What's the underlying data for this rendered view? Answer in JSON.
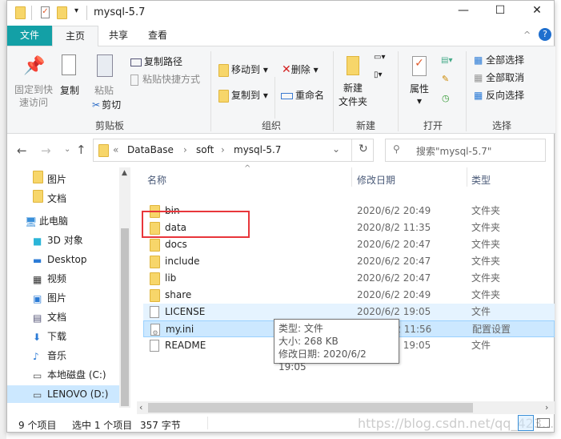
{
  "window": {
    "title": "mysql-5.7",
    "minimize": "—",
    "maximize": "☐",
    "close": "✕"
  },
  "tabs": [
    {
      "label": "文件",
      "active": false,
      "color": "#13a0a6"
    },
    {
      "label": "主页",
      "active": true
    },
    {
      "label": "共享"
    },
    {
      "label": "查看"
    }
  ],
  "ribbon": {
    "clipboard": {
      "label": "剪贴板",
      "pin": "固定到快速访问",
      "pin1": "固定到快",
      "pin2": "速访问",
      "copy": "复制",
      "paste": "粘贴",
      "copy_path": "复制路径",
      "paste_shortcut": "粘贴快捷方式",
      "cut": "剪切"
    },
    "organize": {
      "label": "组织",
      "move_to": "移动到",
      "copy_to": "复制到",
      "delete": "删除",
      "rename": "重命名"
    },
    "new": {
      "label": "新建",
      "new_folder1": "新建",
      "new_folder2": "文件夹"
    },
    "open": {
      "label": "打开",
      "properties": "属性"
    },
    "select": {
      "label": "选择",
      "select_all": "全部选择",
      "select_none": "全部取消",
      "invert": "反向选择"
    }
  },
  "address": {
    "breadcrumb": [
      "DataBase",
      "soft",
      "mysql-5.7"
    ],
    "prefix": "«",
    "search_placeholder": "搜索\"mysql-5.7\""
  },
  "nav": [
    {
      "label": "图片",
      "icon": "folder-icon"
    },
    {
      "label": "文档",
      "icon": "folder-icon"
    },
    {
      "label": "此电脑",
      "icon": "computer-icon"
    },
    {
      "label": "3D 对象",
      "icon": "cube-icon"
    },
    {
      "label": "Desktop",
      "icon": "desktop-icon"
    },
    {
      "label": "视频",
      "icon": "video-icon"
    },
    {
      "label": "图片",
      "icon": "picture-icon"
    },
    {
      "label": "文档",
      "icon": "document-icon"
    },
    {
      "label": "下载",
      "icon": "download-icon"
    },
    {
      "label": "音乐",
      "icon": "music-icon"
    },
    {
      "label": "本地磁盘 (C:)",
      "icon": "drive-icon"
    },
    {
      "label": "LENOVO (D:)",
      "icon": "drive-icon",
      "selected": true
    }
  ],
  "columns": {
    "name": "名称",
    "date": "修改日期",
    "type": "类型"
  },
  "files": [
    {
      "name": "bin",
      "date": "2020/6/2 20:49",
      "type": "文件夹",
      "kind": "folder"
    },
    {
      "name": "data",
      "date": "2020/8/2 11:35",
      "type": "文件夹",
      "kind": "folder"
    },
    {
      "name": "docs",
      "date": "2020/6/2 20:47",
      "type": "文件夹",
      "kind": "folder"
    },
    {
      "name": "include",
      "date": "2020/6/2 20:47",
      "type": "文件夹",
      "kind": "folder"
    },
    {
      "name": "lib",
      "date": "2020/6/2 20:47",
      "type": "文件夹",
      "kind": "folder"
    },
    {
      "name": "share",
      "date": "2020/6/2 20:49",
      "type": "文件夹",
      "kind": "folder"
    },
    {
      "name": "LICENSE",
      "date": "2020/6/2 19:05",
      "type": "文件",
      "kind": "file",
      "hover": true
    },
    {
      "name": "my.ini",
      "date": "2020/8/2 11:56",
      "type": "配置设置",
      "kind": "ini",
      "selected": true
    },
    {
      "name": "README",
      "date": "2020/6/2 19:05",
      "type": "文件",
      "kind": "file"
    }
  ],
  "tooltip": {
    "type": "类型: 文件",
    "size": "大小: 268 KB",
    "modified": "修改日期: 2020/6/2 19:05"
  },
  "status": {
    "count": "9 个项目",
    "selected": "选中 1 个项目",
    "size": "357 字节"
  },
  "watermark": "https://blog.csdn.net/qq_423...",
  "highlight_color": "#e8363b"
}
